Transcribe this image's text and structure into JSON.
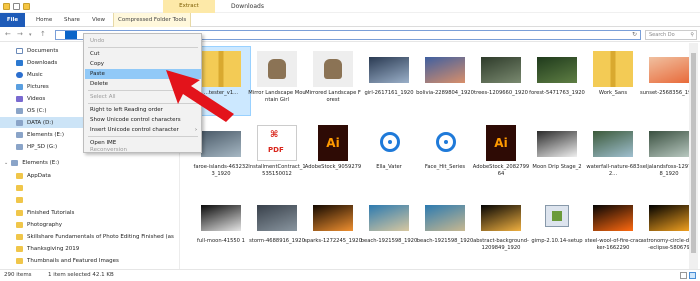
{
  "window": {
    "title": "Downloads",
    "context_tab": "Extract"
  },
  "ribbon": {
    "tabs": [
      "File",
      "Home",
      "Share",
      "View",
      "Compressed Folder Tools"
    ]
  },
  "address": {
    "selected_text": "",
    "search_placeholder": "Search Do"
  },
  "sidebar": {
    "items": [
      {
        "label": "Documents",
        "icon": "document-icon"
      },
      {
        "label": "Downloads",
        "icon": "download-icon"
      },
      {
        "label": "Music",
        "icon": "music-icon"
      },
      {
        "label": "Pictures",
        "icon": "pictures-icon"
      },
      {
        "label": "Videos",
        "icon": "videos-icon"
      },
      {
        "label": "OS (C:)",
        "icon": "drive-icon"
      },
      {
        "label": "DATA (D:)",
        "icon": "drive-icon"
      },
      {
        "label": "Elements (E:)",
        "icon": "drive-icon"
      },
      {
        "label": "HP_SD (G:)",
        "icon": "drive-icon"
      },
      {
        "label": "Elements (E:)",
        "icon": "drive-icon"
      },
      {
        "label": "AppData",
        "icon": "folder-icon"
      },
      {
        "label": "",
        "icon": "folder-icon"
      },
      {
        "label": "",
        "icon": "folder-icon"
      },
      {
        "label": "Finished Tutorials",
        "icon": "folder-icon"
      },
      {
        "label": "Photography",
        "icon": "folder-icon"
      },
      {
        "label": "Skillshare Fundamentals of Photo Editing Finished (as",
        "icon": "folder-icon"
      },
      {
        "label": "Thanksgiving 2019",
        "icon": "folder-icon"
      },
      {
        "label": "Thumbnails and Featured Images",
        "icon": "folder-icon"
      }
    ]
  },
  "context_menu": {
    "items": [
      {
        "label": "Undo",
        "disabled": true
      },
      {
        "label": "Cut",
        "disabled": false
      },
      {
        "label": "Copy",
        "disabled": false
      },
      {
        "label": "Paste",
        "disabled": false
      },
      {
        "label": "Delete",
        "disabled": false
      },
      {
        "label": "Select All",
        "disabled": true
      },
      {
        "label": "Right to left Reading order",
        "disabled": false
      },
      {
        "label": "Show Unicode control characters",
        "disabled": false
      },
      {
        "label": "Insert Unicode control character",
        "disabled": false
      },
      {
        "label": "Open IME",
        "disabled": false
      },
      {
        "label": "Reconversion",
        "disabled": true
      }
    ],
    "highlighted": "Paste"
  },
  "files": [
    {
      "name": "...tester_v1...",
      "type": "zip",
      "selected": true
    },
    {
      "name": "Mirror Landscape Mountain Girl",
      "type": "gimp"
    },
    {
      "name": "Mirrored Landscape Forest",
      "type": "gimp"
    },
    {
      "name": "girl-2617161_1920",
      "type": "photo",
      "colors": [
        "#2a3a52",
        "#9bb0c9"
      ]
    },
    {
      "name": "bolivia-2289804_1920",
      "type": "photo",
      "colors": [
        "#3f5fa0",
        "#d98f6a"
      ]
    },
    {
      "name": "trees-1209660_1920",
      "type": "photo",
      "colors": [
        "#2e3b2a",
        "#7a8a70"
      ]
    },
    {
      "name": "forest-5471763_1920",
      "type": "photo",
      "colors": [
        "#1f3a1c",
        "#5f7f44"
      ]
    },
    {
      "name": "Work_Sans",
      "type": "zip"
    },
    {
      "name": "sunset-2568356_1920",
      "type": "photo",
      "colors": [
        "#f0c0a0",
        "#e86a3a"
      ]
    },
    {
      "name": "faroe-islands-4632323_1920",
      "type": "photo",
      "colors": [
        "#4a5a68",
        "#a7b8c4"
      ]
    },
    {
      "name": "InstallmentContract_1535150012",
      "type": "pdf"
    },
    {
      "name": "AdobeStock_9059279",
      "type": "ai"
    },
    {
      "name": "Ella_Vater",
      "type": "mp4"
    },
    {
      "name": "Face_Hit_Series",
      "type": "mp4"
    },
    {
      "name": "AdobeStock_208279964",
      "type": "ai"
    },
    {
      "name": "Moon Drip Stage_2",
      "type": "photo",
      "colors": [
        "#2a2a2a",
        "#f0f0f0"
      ]
    },
    {
      "name": "waterfall-nature-6832...",
      "type": "photo",
      "colors": [
        "#3c5a3a",
        "#a0c0d0"
      ]
    },
    {
      "name": "seljalandsfoss-1297958_1920",
      "type": "photo",
      "colors": [
        "#3a5040",
        "#b8c8c0"
      ]
    },
    {
      "name": "full-moon-41550 1",
      "type": "photo",
      "colors": [
        "#0a0a0a",
        "#e6e6e6"
      ]
    },
    {
      "name": "storm-4688916_1920",
      "type": "photo",
      "colors": [
        "#38404a",
        "#8a96a0"
      ]
    },
    {
      "name": "sparks-1272245_1920",
      "type": "photo",
      "colors": [
        "#120800",
        "#f09030"
      ]
    },
    {
      "name": "beach-1921598_1920",
      "type": "photo",
      "colors": [
        "#2c7ab0",
        "#d8c8a0"
      ]
    },
    {
      "name": "beach-1921598_1920",
      "type": "photo",
      "colors": [
        "#2c7ab0",
        "#c8b890"
      ]
    },
    {
      "name": "abstract-background-1209849_1920",
      "type": "photo",
      "colors": [
        "#040404",
        "#f0b040"
      ]
    },
    {
      "name": "gimp-2.10.14-setup",
      "type": "exe"
    },
    {
      "name": "steel-wool-of-fire-cracker-1662290",
      "type": "photo",
      "colors": [
        "#050505",
        "#ff6a10"
      ]
    },
    {
      "name": "astronomy-circle-dark-eclipse-580679",
      "type": "photo",
      "colors": [
        "#000000",
        "#f0a020"
      ]
    }
  ],
  "status": {
    "count": "290 items",
    "selection": "1 item selected  42.1 KB"
  }
}
